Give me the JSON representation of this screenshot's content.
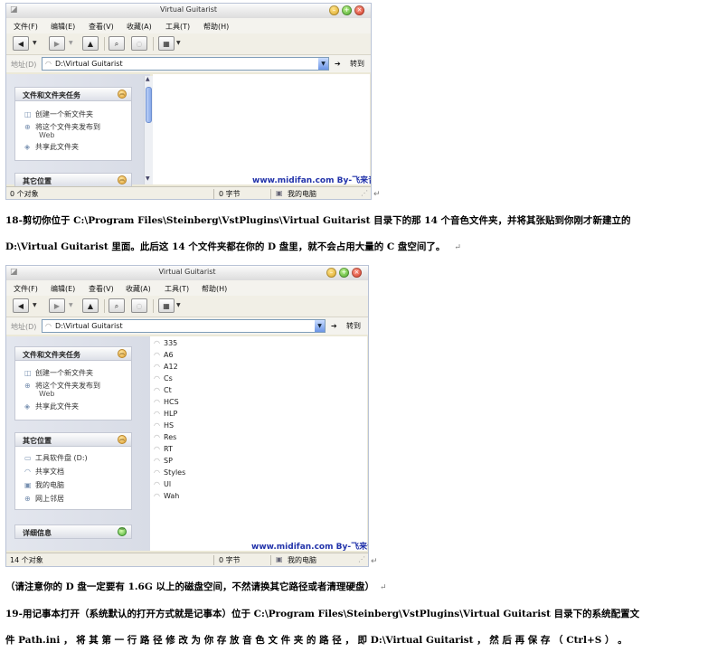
{
  "window1": {
    "title": "Virtual Guitarist",
    "menu": [
      "文件(F)",
      "编辑(E)",
      "查看(V)",
      "收藏(A)",
      "工具(T)",
      "帮助(H)"
    ],
    "address_label": "地址(D)",
    "address_value": "D:\\Virtual Guitarist",
    "go_label": "转到",
    "tasks_title": "文件和文件夹任务",
    "tasks": [
      "创建一个新文件夹",
      "将这个文件夹发布到",
      "共享此文件夹"
    ],
    "tasks_sub": "Web",
    "other_title": "其它位置",
    "watermark": "www.midifan.com  By-飞来音",
    "status_objects": "0 个对象",
    "status_bytes": "0 字节",
    "status_computer": "我的电脑"
  },
  "para18_line1": "18-剪切你位于  C:\\Program Files\\Steinberg\\VstPlugins\\Virtual  Guitarist  目录下的那  14  个音色文件夹，并将其张贴到你刚才新建立的",
  "para18_line2": "D:\\Virtual Guitarist 里面。此后这 14 个文件夹都在你的 D 盘里，就不会占用大量的 C 盘空间了。",
  "return_mark": "↵",
  "window2": {
    "title": "Virtual Guitarist",
    "menu": [
      "文件(F)",
      "编辑(E)",
      "查看(V)",
      "收藏(A)",
      "工具(T)",
      "帮助(H)"
    ],
    "address_label": "地址(D)",
    "address_value": "D:\\Virtual Guitarist",
    "go_label": "转到",
    "tasks_title": "文件和文件夹任务",
    "tasks": [
      "创建一个新文件夹",
      "将这个文件夹发布到",
      "共享此文件夹"
    ],
    "tasks_sub": "Web",
    "other_title": "其它位置",
    "places": [
      "工具软件盘 (D:)",
      "共享文档",
      "我的电脑",
      "网上邻居"
    ],
    "details_title": "详细信息",
    "folders": [
      "335",
      "A6",
      "A12",
      "Cs",
      "Ct",
      "HCS",
      "HLP",
      "HS",
      "Res",
      "RT",
      "SP",
      "Styles",
      "Ul",
      "Wah"
    ],
    "watermark": "www.midifan.com  By-飞来音",
    "status_objects": "14 个对象",
    "status_bytes": "0 字节",
    "status_computer": "我的电脑"
  },
  "note_line": "（请注意你的 D 盘一定要有 1.6G 以上的磁盘空间，不然请换其它路径或者清理硬盘）",
  "para19_line1": " 19-用记事本打开（系统默认的打开方式就是记事本）位于 C:\\Program Files\\Steinberg\\VstPlugins\\Virtual Guitarist 目录下的系统配置文",
  "para19_line2": "件  Path.ini ， 将 其 第 一 行 路 径 修 改 为 你 存 放 音 色 文 件 夹 的 路 径 ， 即   D:\\Virtual   Guitarist ， 然 后 再 保 存 （ Ctrl+S ） 。",
  "colors": {
    "watermark": "#2233aa",
    "chrome": "#ece9d8",
    "taskpane": "#dde1ea"
  }
}
